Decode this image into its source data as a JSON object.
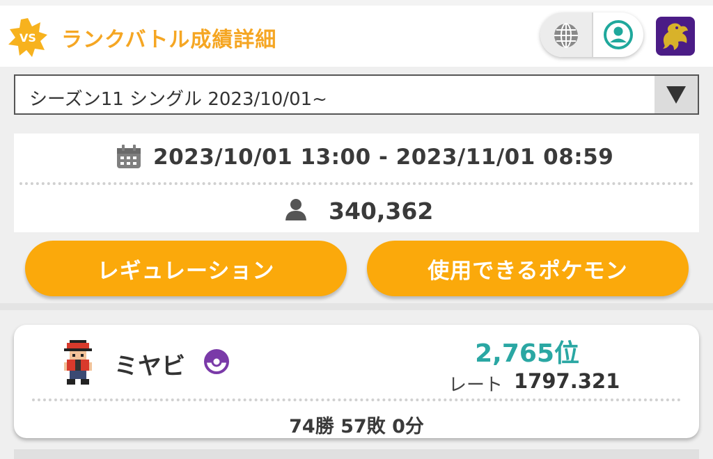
{
  "header": {
    "badge_text": "VS",
    "title": "ランクバトル成績詳細",
    "icons": {
      "globe": "globe-icon",
      "account": "account-icon",
      "app": "app-icon"
    },
    "accent_color": "#f5a623"
  },
  "season_select": {
    "selected": "シーズン11 シングル 2023/10/01~"
  },
  "season_info": {
    "period": "2023/10/01 13:00 - 2023/11/01 08:59",
    "players": "340,362"
  },
  "buttons": {
    "regulation": "レギュレーション",
    "usable_pokemon": "使用できるポケモン",
    "color": "#fba90b"
  },
  "result": {
    "name": "ミヤビ",
    "rank": "2,765位",
    "rate_label": "レート",
    "rate_value": "1797.321",
    "record": "74勝 57敗 0分",
    "rank_color": "#2aa7a3"
  }
}
